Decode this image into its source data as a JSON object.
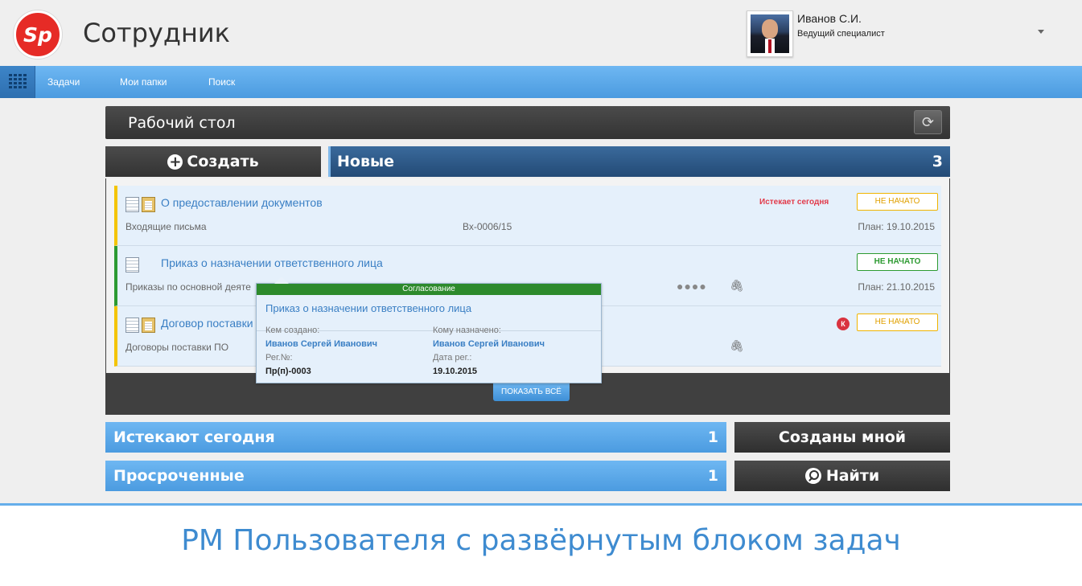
{
  "header": {
    "logo_text": "Sp",
    "app_title": "Сотрудник",
    "user_name": "Иванов С.И.",
    "user_role": "Ведущий специалист"
  },
  "nav": {
    "items": [
      "Задачи",
      "Мои папки",
      "Поиск"
    ]
  },
  "desk": {
    "title": "Рабочий стол",
    "refresh_icon": "refresh-icon"
  },
  "create": {
    "label": "Создать"
  },
  "new_block": {
    "title": "Новые",
    "count": "3"
  },
  "tasks": [
    {
      "title": "О предоставлении документов",
      "category": "Входящие письма",
      "number": "Вх-0006/15",
      "expire": "Истекает сегодня",
      "status": "НЕ НАЧАТО",
      "plan": "План: 19.10.2015"
    },
    {
      "title": "Приказ о назначении ответственного лица",
      "category": "Приказы по основной деяте",
      "status": "НЕ НАЧАТО",
      "plan": "План: 21.10.2015",
      "dots": "●●●●"
    },
    {
      "title": "Договор поставки",
      "category": "Договоры поставки ПО",
      "k_badge": "К",
      "status": "НЕ НАЧАТО"
    }
  ],
  "tooltip": {
    "stage": "Согласование",
    "title": "Приказ о назначении ответственного лица",
    "created_by_label": "Кем создано:",
    "created_by": "Иванов Сергей Иванович",
    "assigned_label": "Кому назначено:",
    "assigned": "Иванов Сергей Иванович",
    "reg_no_label": "Рег.№:",
    "reg_no": "Пр(п)-0003",
    "reg_date_label": "Дата рег.:",
    "reg_date": "19.10.2015"
  },
  "show_all": "ПОКАЗАТЬ ВСЁ",
  "widgets": {
    "expire_today": {
      "label": "Истекают сегодня",
      "count": "1"
    },
    "overdue": {
      "label": "Просроченные",
      "count": "1"
    },
    "created_by_me": "Созданы мной",
    "find": "Найти"
  },
  "caption": "РМ Пользователя с развёрнутым блоком задач",
  "colors": {
    "brand_red": "#e62b26",
    "nav_blue": "#4b9be0",
    "dark_bar": "#333333",
    "link_blue": "#3a7fc4",
    "status_yellow": "#f0b400",
    "status_green": "#2d9a31",
    "expire_red": "#e23a4a"
  }
}
